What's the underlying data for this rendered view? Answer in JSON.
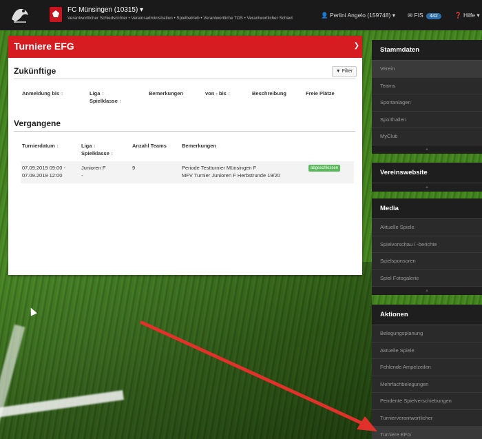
{
  "topbar": {
    "club_name": "FC Münsingen (10315) ▾",
    "club_roles": "Verantwortlicher Schiedsrichter • Vereinsadministration • Spielbetrieb • Verantwortliche TOS • Verantwortlicher Schied",
    "user": "Perlini Angelo (159748) ▾",
    "fis_label": "FIS",
    "fis_count": "442",
    "help_label": "Hilfe ▾"
  },
  "panel": {
    "title": "Turniere EFG",
    "upcoming": {
      "title": "Zukünftige",
      "filter_label": "Filter",
      "columns": [
        {
          "label": "Anmeldung bis",
          "sort": "↕"
        },
        {
          "label": "Liga",
          "sort": "↕",
          "label2": "Spielklasse",
          "sort2": "↕"
        },
        {
          "label": "Bemerkungen"
        },
        {
          "label": "von - bis",
          "sort": "↕"
        },
        {
          "label": "Beschreibung"
        },
        {
          "label": "Freie Plätze"
        }
      ]
    },
    "past": {
      "title": "Vergangene",
      "columns": [
        {
          "label": "Turnierdatum",
          "sort": "↕"
        },
        {
          "label": "Liga",
          "sort": "↕",
          "label2": "Spielklasse",
          "sort2": "↕"
        },
        {
          "label": "Anzahl Teams"
        },
        {
          "label": "Bemerkungen"
        }
      ],
      "rows": [
        {
          "date_line1": "07.09.2019 09:00 -",
          "date_line2": "07.09.2019 12:00",
          "liga": "Junioren F",
          "spielklasse": "-",
          "teams": "9",
          "remark_line1": "Periode Testturnier Münsingen F",
          "remark_line2": "MFV Turnier Junioren F Herbstrunde 19/20",
          "status": "abgeschlossen"
        }
      ]
    }
  },
  "sidebar": {
    "stammdaten": {
      "title": "Stammdaten",
      "items": [
        "Verein",
        "Teams",
        "Sportanlagen",
        "Sporthallen",
        "MyClub"
      ]
    },
    "vereinswebsite": {
      "title": "Vereinswebsite"
    },
    "media": {
      "title": "Media",
      "items": [
        "Aktuelle Spiele",
        "Spielvorschau / -berichte",
        "Spielsponsoren",
        "Spiel Fotogalerie"
      ]
    },
    "aktionen": {
      "title": "Aktionen",
      "items": [
        "Belegungsplanung",
        "Aktuelle Spiele",
        "Fehlende Ampelzeilen",
        "Mehrfachbelegungen",
        "Pendente Spielverschiebungen",
        "Turnierverantwortlicher",
        "Turniere EFG"
      ]
    }
  },
  "colors": {
    "accent_red": "#d71c21",
    "status_green": "#5cb85c",
    "topbar": "#1a1a1a",
    "sidebar": "#2a2a2a"
  }
}
